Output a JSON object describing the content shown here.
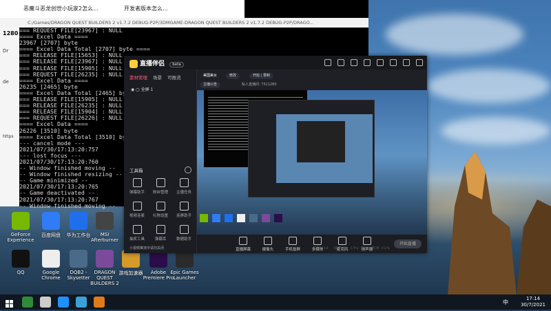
{
  "browser": {
    "tab1": "恶魔斗恶龙创世小玩家2怎么...",
    "tab2": "开发者版本怎么...",
    "address": "C:/Games/DRAGON QUEST BUILDERS 2 v1.7.2 DEBUG-P2P/3DMGAME-DRAGON QUEST BUILDERS 2 v1.7.2 DEBUG-P2P/DRAGO..."
  },
  "side_labels": {
    "s1": "1280",
    "s2": "Dr",
    "s3": "de",
    "s4": "https"
  },
  "console_lines": [
    "=== REQUEST FILE[23967] : NULL",
    "==== Excel Data ====",
    "23967 [2707] byte",
    "==== Excel Data Total [2707] byte ====",
    "=== RELEASE FILE[15653] : NULL",
    "=== RELEASE FILE[23967] : NULL",
    "=== RELEASE FILE[15905] : NULL",
    "=== REQUEST FILE[26235] : NULL",
    "==== Excel Data ====",
    "26235 [2465] byte",
    "==== Excel Data Total [2465] byte ====",
    "=== RELEASE FILE[15905] : NULL",
    "=== RELEASE FILE[26235] : NULL",
    "=== RELEASE FILE[15904] : NULL",
    "=== REQUEST FILE[26226] : NULL",
    "==== Excel Data ====",
    "26226 [3510] byte",
    "==== Excel Data Total [3510] byte ====",
    "--- cancel mode ---",
    "2021/07/30/17:13:20:757",
    "--- lost focus ---",
    "2021/07/30/17:13:20:760",
    "-- Window finished moving --",
    "-- Window finished resizing --",
    "-- Game minimized --",
    "2021/07/30/17:13:20:765",
    "-- Game deactivated --",
    "2021/07/30/17:13:20:767",
    "-- Window finished moving --"
  ],
  "app": {
    "name": "直播伴侣",
    "badge": "beta",
    "left_tabs": [
      "素材管理",
      "场景",
      "可推流"
    ],
    "scene_label": "全屏 1",
    "tools_title": "工具箱",
    "tools": [
      "弹幕助手",
      "粉丝管理",
      "主播任务",
      "视频连麦",
      "礼物设置",
      "连屏助手",
      "抽奖工具",
      "弹幕库",
      "数据助手"
    ],
    "bottom_note": "小视频推流中请勿关闭",
    "top_chips": [
      "美国美女",
      "修改",
      "主播公告",
      "全屏 1",
      "开始 | 录制"
    ],
    "user_label": "私人直播间: 7511280",
    "bottom_items": [
      "直播屏幕",
      "摄像头",
      "手机投屏",
      "多媒体",
      "麦克风",
      "扬声器"
    ],
    "start_label": "开始直播",
    "stats": [
      "FPS:30",
      "码率:0",
      "CPU:5%",
      "内存:42%"
    ]
  },
  "desktop_icons": [
    {
      "label": "GeForce Experience",
      "icon": "nvidia-icon",
      "color": "#76b900"
    },
    {
      "label": "百度网盘",
      "icon": "baidu-icon",
      "color": "#2f7cf6"
    },
    {
      "label": "华为工作台",
      "icon": "cloud-icon",
      "color": "#1f6feb"
    },
    {
      "label": "MSI Afterburner",
      "icon": "msi-icon",
      "color": "#444"
    },
    {
      "label": "QQ",
      "icon": "qq-icon",
      "color": "#111"
    },
    {
      "label": "Google Chrome",
      "icon": "chrome-icon",
      "color": "#eee"
    },
    {
      "label": "DQB2 - Skysetter",
      "icon": "game-icon",
      "color": "#4a6a8a"
    },
    {
      "label": "DRAGON QUEST BUILDERS 2",
      "icon": "dqb-icon",
      "color": "#7a4b9a"
    },
    {
      "label": "游戏加速器",
      "icon": "boost-icon",
      "color": "#d49a2a"
    },
    {
      "label": "Adobe Premiere Pro",
      "icon": "premiere-icon",
      "color": "#2a0d4a"
    },
    {
      "label": "Epic Games Launcher",
      "icon": "epic-icon",
      "color": "#2b2b2b"
    }
  ],
  "taskbar": {
    "lang": "中",
    "time": "17:14",
    "date": "30/7/2021"
  }
}
